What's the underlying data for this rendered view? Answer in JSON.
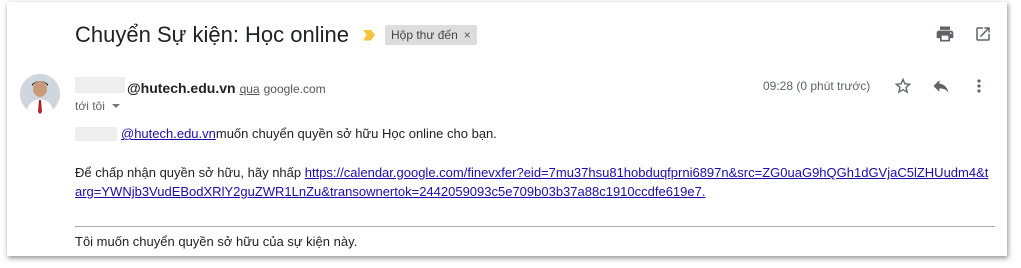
{
  "email": {
    "subject": "Chuyển Sự kiện: Học online",
    "label": "Hộp thư đến",
    "label_close": "×",
    "label_color": "#f6c33c",
    "sender_email": "@hutech.edu.vn",
    "via_text": "qua",
    "via_domain": "google.com",
    "to_text": "tới tôi",
    "time": "09:28 (0 phút trước)",
    "body_line1_link": "@hutech.edu.vn",
    "body_line1_text": " muốn chuyển quyền sở hữu Học online cho bạn.",
    "body_line2_prefix": "Để chấp nhận quyền sở hữu, hãy nhấp ",
    "body_line2_link": "https://calendar.google.com/finevxfer?eid=7mu37hsu81hobduqfprni6897n&src=ZG0uaG9hQGh1dGVjaC5lZHUudm4&targ=YWNjb3VudEBodXRlY2guZWR1LnZu&transownertok=2442059093c5e709b03b37a88c1910ccdfe619e7.",
    "footer_text": "Tôi muốn chuyển quyền sở hữu của sự kiện này."
  },
  "icons": {
    "print": "print-icon",
    "open_new": "open-in-new-window-icon",
    "star": "star-icon",
    "reply": "reply-icon",
    "more": "more-vertical-icon"
  },
  "colors": {
    "link": "#1a0dab",
    "label_bg": "#dddddd"
  }
}
